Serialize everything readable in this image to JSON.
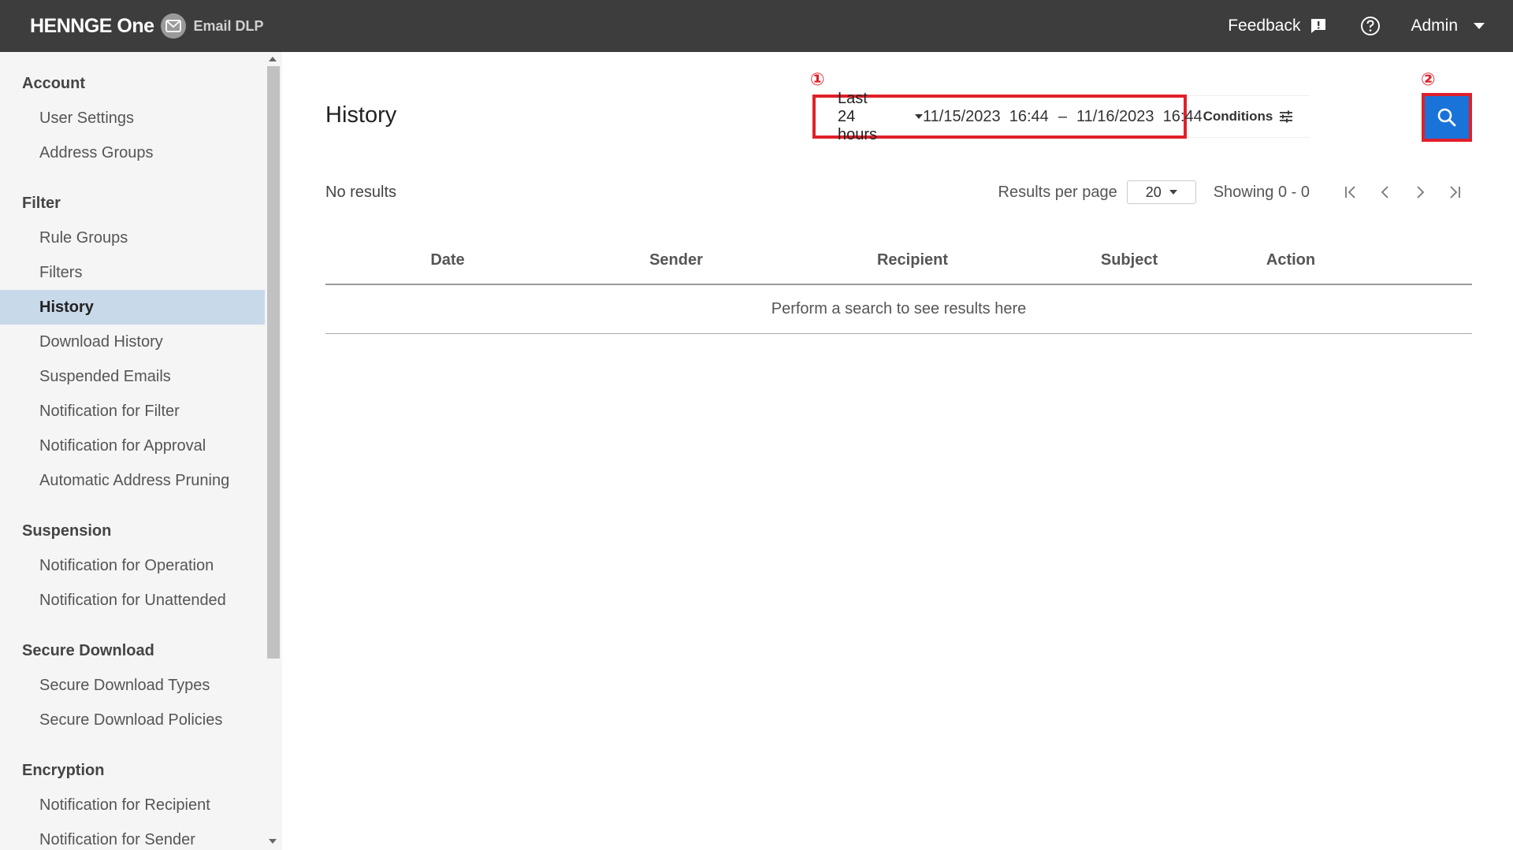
{
  "app": {
    "brand": "HENNGE One",
    "product": "Email DLP"
  },
  "topbar": {
    "feedback_label": "Feedback",
    "admin_label": "Admin"
  },
  "sidebar": {
    "sections": [
      {
        "title": "Account",
        "items": [
          "User Settings",
          "Address Groups"
        ]
      },
      {
        "title": "Filter",
        "items": [
          "Rule Groups",
          "Filters",
          "History",
          "Download History",
          "Suspended Emails",
          "Notification for Filter",
          "Notification for Approval",
          "Automatic Address Pruning"
        ]
      },
      {
        "title": "Suspension",
        "items": [
          "Notification for Operation",
          "Notification for Unattended"
        ]
      },
      {
        "title": "Secure Download",
        "items": [
          "Secure Download Types",
          "Secure Download Policies"
        ]
      },
      {
        "title": "Encryption",
        "items": [
          "Notification for Recipient",
          "Notification for Sender"
        ]
      }
    ],
    "active_item": "History"
  },
  "main": {
    "title": "History",
    "marker_1": "①",
    "marker_2": "②",
    "range_select": "Last 24 hours",
    "date_from": "11/15/2023  16:44",
    "date_sep": "–",
    "date_to": "11/16/2023  16:44",
    "conditions_label": "Conditions",
    "no_results": "No results",
    "results_per_page_label": "Results per page",
    "results_per_page_value": "20",
    "showing": "Showing 0 - 0",
    "columns": [
      "Date",
      "Sender",
      "Recipient",
      "Subject",
      "Action"
    ],
    "empty_message": "Perform a search to see results here"
  },
  "colors": {
    "topbar": "#3d3d3d",
    "highlight_red": "#e0202a",
    "search_blue": "#1a73d9",
    "active_nav": "#c8d9ea"
  }
}
